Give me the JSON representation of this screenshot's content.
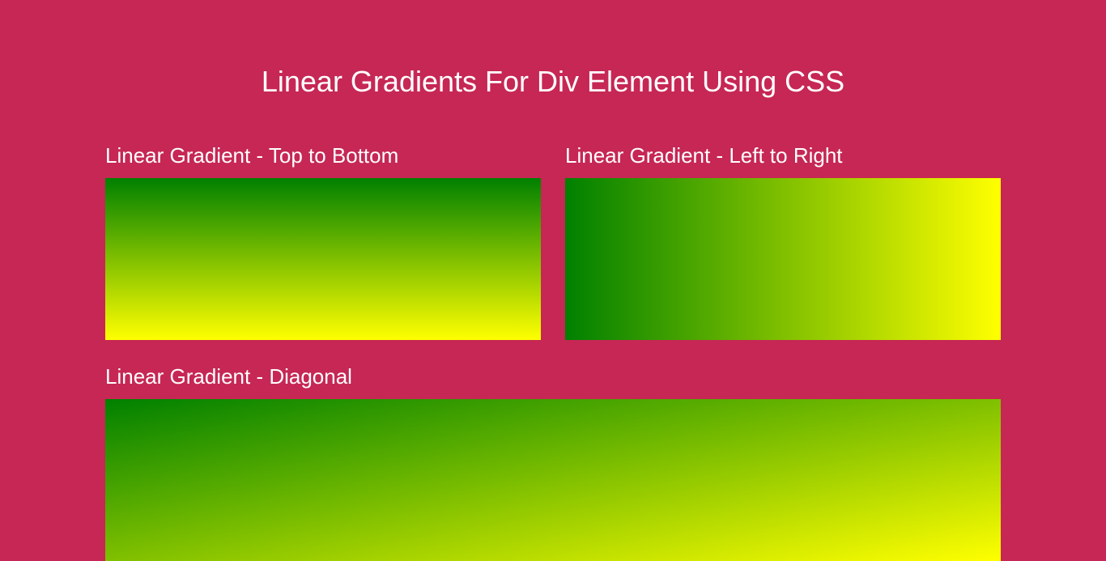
{
  "page": {
    "title": "Linear Gradients For Div Element Using CSS"
  },
  "cards": {
    "topBottom": {
      "title": "Linear Gradient - Top to Bottom"
    },
    "leftRight": {
      "title": "Linear Gradient - Left to Right"
    },
    "diagonal": {
      "title": "Linear Gradient - Diagonal"
    }
  }
}
